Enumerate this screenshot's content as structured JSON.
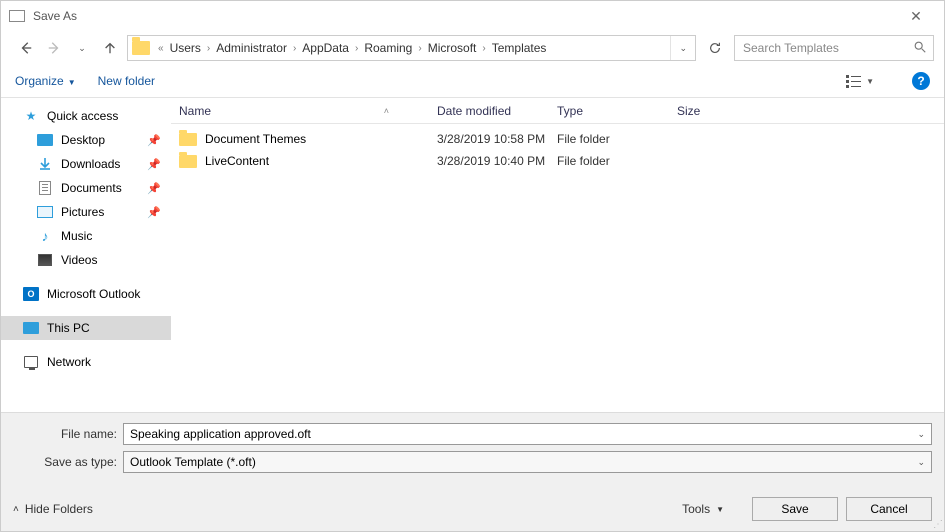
{
  "window": {
    "title": "Save As"
  },
  "nav": {
    "recent_symbol": "⌄",
    "breadcrumbs": [
      "Users",
      "Administrator",
      "AppData",
      "Roaming",
      "Microsoft",
      "Templates"
    ],
    "chevron_prefix": "«"
  },
  "search": {
    "placeholder": "Search Templates"
  },
  "toolbar": {
    "organize": "Organize",
    "new_folder": "New folder"
  },
  "sidebar": {
    "quick_access": "Quick access",
    "desktop": "Desktop",
    "downloads": "Downloads",
    "documents": "Documents",
    "pictures": "Pictures",
    "music": "Music",
    "videos": "Videos",
    "outlook": "Microsoft Outlook",
    "this_pc": "This PC",
    "network": "Network"
  },
  "columns": {
    "name": "Name",
    "date": "Date modified",
    "type": "Type",
    "size": "Size"
  },
  "rows": [
    {
      "name": "Document Themes",
      "date": "3/28/2019 10:58 PM",
      "type": "File folder"
    },
    {
      "name": "LiveContent",
      "date": "3/28/2019 10:40 PM",
      "type": "File folder"
    }
  ],
  "form": {
    "filename_label": "File name:",
    "filename_value": "Speaking application approved.oft",
    "type_label": "Save as type:",
    "type_value": "Outlook Template (*.oft)"
  },
  "footer": {
    "hide_folders": "Hide Folders",
    "tools": "Tools",
    "save": "Save",
    "cancel": "Cancel"
  },
  "help_char": "?"
}
